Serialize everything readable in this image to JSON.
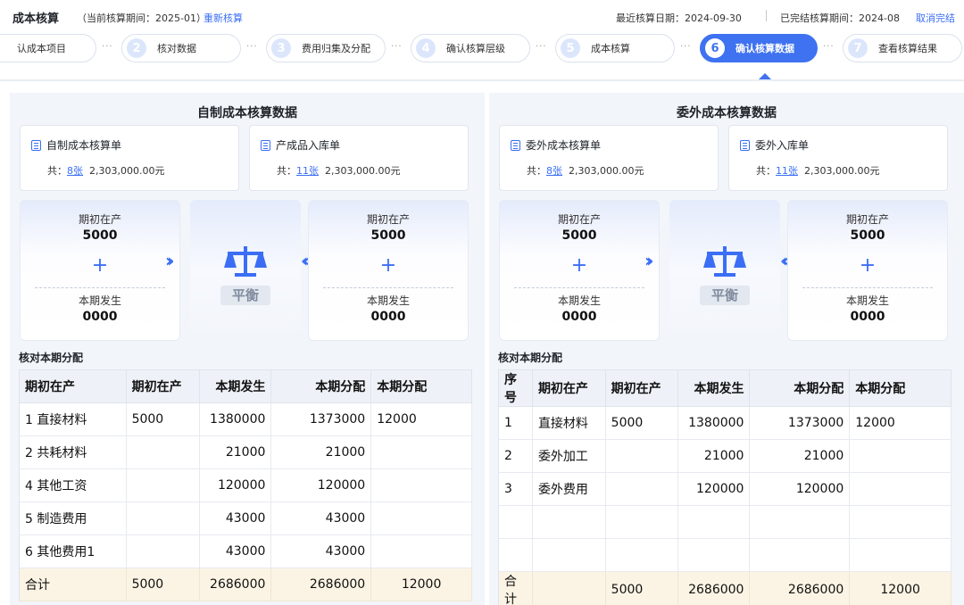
{
  "header": {
    "title": "成本核算",
    "period": "（当前核算期间：2025-01）",
    "recalc": "重新核算",
    "recent": "最近核算日期：2024-09-30",
    "done": "已完结核算期间：2024-08",
    "cancel": "取消完结"
  },
  "steps": [
    {
      "num": "",
      "label": "认成本项目"
    },
    {
      "num": "2",
      "label": "核对数据"
    },
    {
      "num": "3",
      "label": "费用归集及分配"
    },
    {
      "num": "4",
      "label": "确认核算层级"
    },
    {
      "num": "5",
      "label": "成本核算"
    },
    {
      "num": "6",
      "label": "确认核算数据"
    },
    {
      "num": "7",
      "label": "查看核算结果"
    }
  ],
  "colors": {
    "accent": "#3f72f0",
    "total_row": "#fbf4e4"
  },
  "left": {
    "title": "自制成本核算数据",
    "card1": {
      "title": "自制成本核算单",
      "prefix": "共：",
      "count": "8张",
      "amount": "2,303,000.00元"
    },
    "card2": {
      "title": "产成品入库单",
      "prefix": "共：",
      "count": "11张",
      "amount": "2,303,000.00元"
    },
    "box1": {
      "label1": "期初在产",
      "value1": "5000",
      "plus": "+",
      "label2": "本期发生",
      "value2": "0000"
    },
    "box2": {
      "label1": "期初在产",
      "value1": "5000",
      "plus": "+",
      "label2": "本期发生",
      "value2": "0000"
    },
    "balance": "平衡",
    "sub": "核对本期分配",
    "table": {
      "headers": [
        "期初在产",
        "期初在产",
        "本期发生",
        "本期分配",
        "本期分配"
      ],
      "rows": [
        [
          "1 直接材料",
          "5000",
          "1380000",
          "1373000",
          "12000"
        ],
        [
          "2 共耗材料",
          "",
          "21000",
          "21000",
          ""
        ],
        [
          "4 其他工资",
          "",
          "120000",
          "120000",
          ""
        ],
        [
          "5 制造费用",
          "",
          "43000",
          "43000",
          ""
        ],
        [
          "6 其他费用1",
          "",
          "43000",
          "43000",
          ""
        ]
      ],
      "total": [
        "合计",
        "5000",
        "2686000",
        "2686000",
        "12000"
      ]
    }
  },
  "right": {
    "title": "委外成本核算数据",
    "card1": {
      "title": "委外成本核算单",
      "prefix": "共：",
      "count": "8张",
      "amount": "2,303,000.00元"
    },
    "card2": {
      "title": "委外入库单",
      "prefix": "共：",
      "count": "11张",
      "amount": "2,303,000.00元"
    },
    "box1": {
      "label1": "期初在产",
      "value1": "5000",
      "plus": "+",
      "label2": "本期发生",
      "value2": "0000"
    },
    "box2": {
      "label1": "期初在产",
      "value1": "5000",
      "plus": "+",
      "label2": "本期发生",
      "value2": "0000"
    },
    "balance": "平衡",
    "sub": "核对本期分配",
    "table": {
      "headers": [
        "序号",
        "期初在产",
        "期初在产",
        "本期发生",
        "本期分配",
        "本期分配"
      ],
      "rows": [
        [
          "1",
          "直接材料",
          "5000",
          "1380000",
          "1373000",
          "12000"
        ],
        [
          "2",
          "委外加工",
          "",
          "21000",
          "21000",
          ""
        ],
        [
          "3",
          "委外费用",
          "",
          "120000",
          "120000",
          ""
        ]
      ],
      "total": [
        "合计",
        "",
        "5000",
        "2686000",
        "2686000",
        "12000"
      ]
    }
  }
}
